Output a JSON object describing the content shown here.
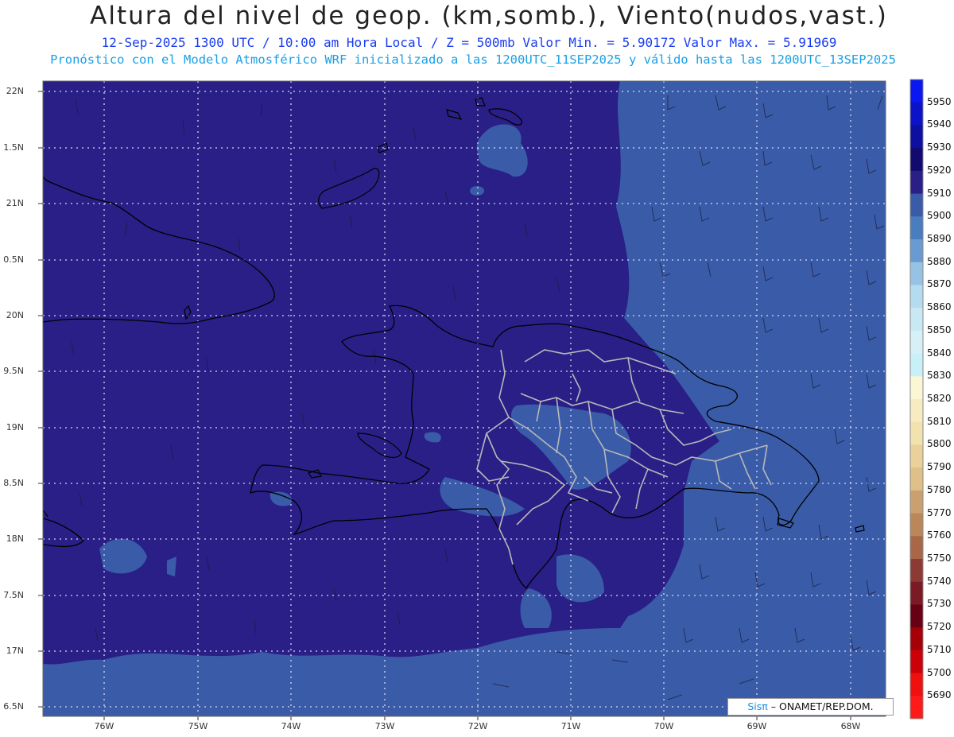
{
  "header": {
    "title": "Altura del nivel de geop. (km,somb.), Viento(nudos,vast.)",
    "subtitle": "12-Sep-2025  1300 UTC / 10:00 am Hora Local / Z = 500mb   Valor Min. = 5.90172  Valor Max. = 5.91969",
    "subtitle2": "Pronóstico con el Modelo Atmosférico WRF inicializado a las 1200UTC_11SEP2025 y válido hasta las  1200UTC_13SEP2025"
  },
  "map": {
    "lat_labels": [
      "22N",
      "1.5N",
      "21N",
      "0.5N",
      "20N",
      "9.5N",
      "19N",
      "8.5N",
      "18N",
      "7.5N",
      "17N",
      "6.5N"
    ],
    "lon_labels": [
      "76W",
      "75W",
      "74W",
      "73W",
      "72W",
      "71W",
      "70W",
      "69W",
      "68W"
    ],
    "colors": {
      "field_5910_5920": "#2a1f86",
      "field_5900_5910": "#3a5ca8",
      "coastline": "#000000",
      "province_borders": "#b8b8b8"
    }
  },
  "colorbar": {
    "levels": [
      "5950",
      "5940",
      "5930",
      "5920",
      "5910",
      "5900",
      "5890",
      "5880",
      "5870",
      "5860",
      "5850",
      "5840",
      "5830",
      "5820",
      "5810",
      "5800",
      "5790",
      "5780",
      "5770",
      "5760",
      "5750",
      "5740",
      "5730",
      "5720",
      "5710",
      "5700",
      "5690"
    ],
    "colors": [
      "#0a17f0",
      "#0b12c8",
      "#0c0fa0",
      "#120a6e",
      "#2a1f86",
      "#3a5ca8",
      "#4a7cc0",
      "#6a9bd0",
      "#96c3e3",
      "#b4dcee",
      "#c8e8f3",
      "#d6f0f6",
      "#c8f0f7",
      "#fbf6d4",
      "#f6ebc1",
      "#f2e2b0",
      "#ead19a",
      "#e0c089",
      "#caa070",
      "#b9875a",
      "#a86848",
      "#8e3a34",
      "#7a1a24",
      "#680014",
      "#a50008",
      "#cc0008",
      "#f01010",
      "#ff1a1a"
    ]
  },
  "credit": {
    "brand": "Sisπ",
    "text": "– ONAMET/REP.DOM."
  }
}
